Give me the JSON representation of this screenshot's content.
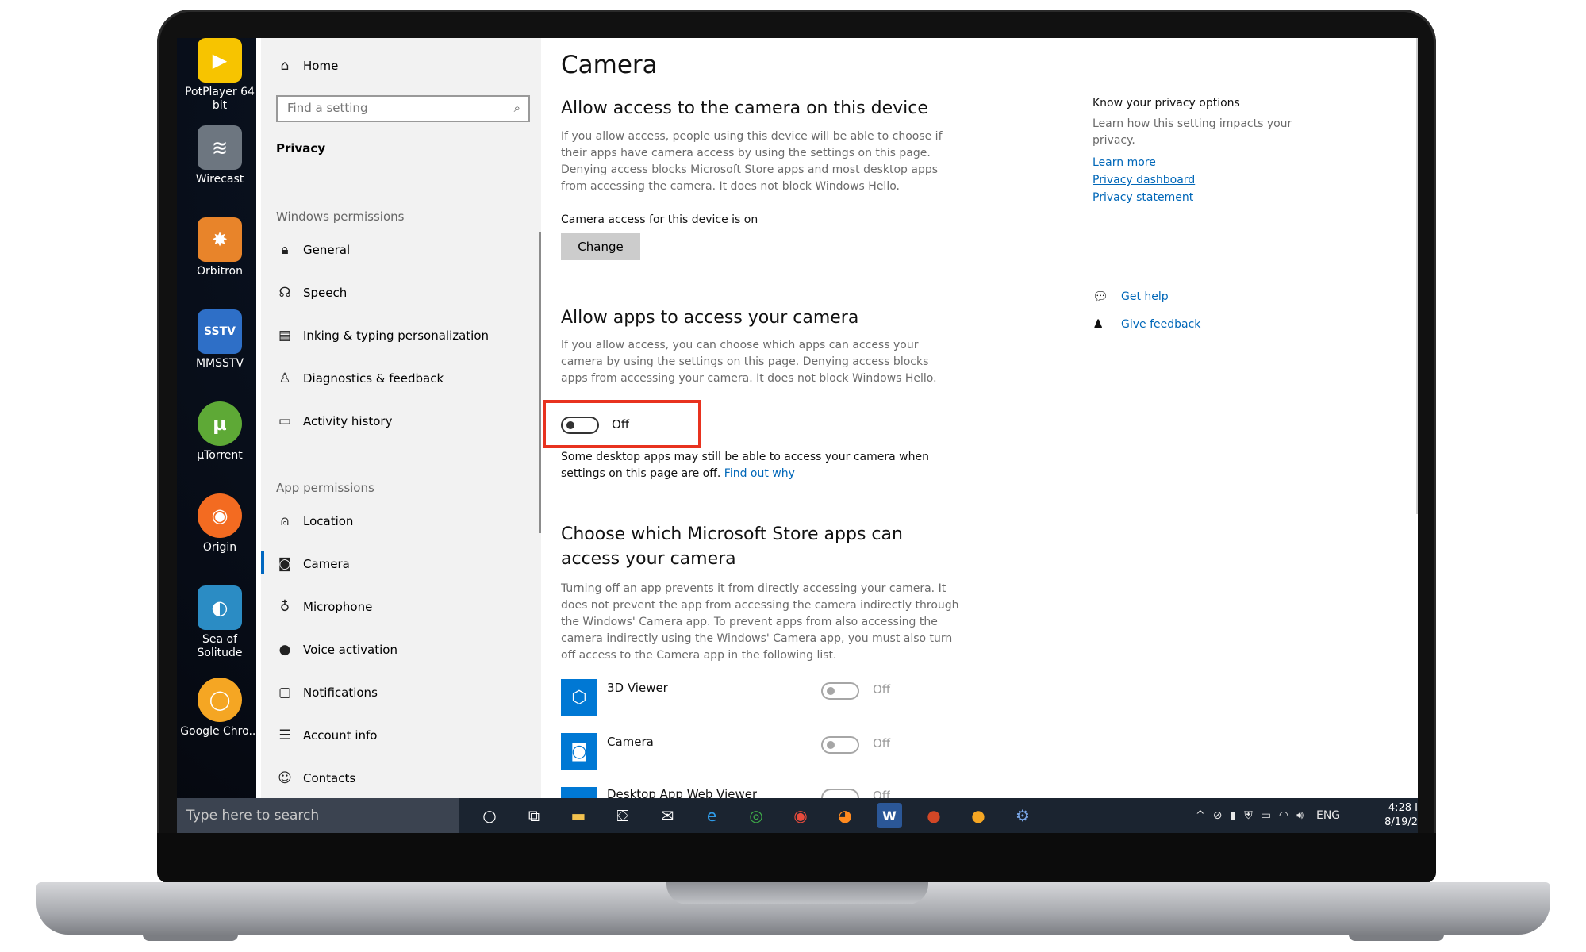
{
  "desktop": {
    "icons": [
      {
        "label": "PotPlayer 64 bit",
        "glyph": "▶",
        "color": "#f7c400"
      },
      {
        "label": "Wirecast",
        "glyph": "≋",
        "color": "#6d7680"
      },
      {
        "label": "Orbitron",
        "glyph": "✸",
        "color": "#e8842a"
      },
      {
        "label": "MMSSTV",
        "glyph": "SSTV",
        "color": "#2e6fc7"
      },
      {
        "label": "µTorrent",
        "glyph": "µ",
        "color": "#5ea936"
      },
      {
        "label": "Origin",
        "glyph": "◉",
        "color": "#f36b21"
      },
      {
        "label": "Sea of Solitude",
        "glyph": "◐",
        "color": "#2b8cc4"
      },
      {
        "label": "Google Chro...",
        "glyph": "◯",
        "color": "#f5a623"
      }
    ]
  },
  "nav": {
    "home": "Home",
    "search_placeholder": "Find a setting",
    "section": "Privacy",
    "windows_permissions_header": "Windows permissions",
    "windows_permissions": [
      "General",
      "Speech",
      "Inking & typing personalization",
      "Diagnostics & feedback",
      "Activity history"
    ],
    "app_permissions_header": "App permissions",
    "app_permissions": [
      "Location",
      "Camera",
      "Microphone",
      "Voice activation",
      "Notifications",
      "Account info",
      "Contacts"
    ],
    "selected": "Camera"
  },
  "content": {
    "title": "Camera",
    "device_heading": "Allow access to the camera on this device",
    "device_desc": "If you allow access, people using this device will be able to choose if their apps have camera access by using the settings on this page. Denying access blocks Microsoft Store apps and most desktop apps from accessing the camera. It does not block Windows Hello.",
    "device_status": "Camera access for this device is on",
    "change_button": "Change",
    "apps_heading": "Allow apps to access your camera",
    "apps_desc": "If you allow access, you can choose which apps can access your camera by using the settings on this page. Denying access blocks apps from accessing your camera. It does not block Windows Hello.",
    "apps_toggle_state": "Off",
    "desktop_note": "Some desktop apps may still be able to access your camera when settings on this page are off.",
    "find_out_why": "Find out why",
    "store_heading": "Choose which Microsoft Store apps can access your camera",
    "store_desc": "Turning off an app prevents it from directly accessing your camera. It does not prevent the app from accessing the camera indirectly through the Windows' Camera app. To prevent apps from also accessing the camera indirectly using the Windows' Camera app, you must also turn off access to the Camera app in the following list.",
    "apps": [
      {
        "name": "3D Viewer",
        "state": "Off",
        "icon": "cube-icon"
      },
      {
        "name": "Camera",
        "state": "Off",
        "icon": "camera-icon"
      },
      {
        "name": "Desktop App Web Viewer",
        "state": "Off",
        "icon": "app-icon"
      }
    ]
  },
  "side": {
    "title": "Know your privacy options",
    "desc": "Learn how this setting impacts your privacy.",
    "links": [
      "Learn more",
      "Privacy dashboard",
      "Privacy statement"
    ],
    "get_help": "Get help",
    "give_feedback": "Give feedback"
  },
  "taskbar": {
    "search_placeholder": "Type here to search",
    "language": "ENG",
    "time": "4:28 I",
    "date": "8/19/2"
  },
  "colors": {
    "accent": "#0067c0",
    "highlight": "#e8321f",
    "link": "#0067b8"
  }
}
